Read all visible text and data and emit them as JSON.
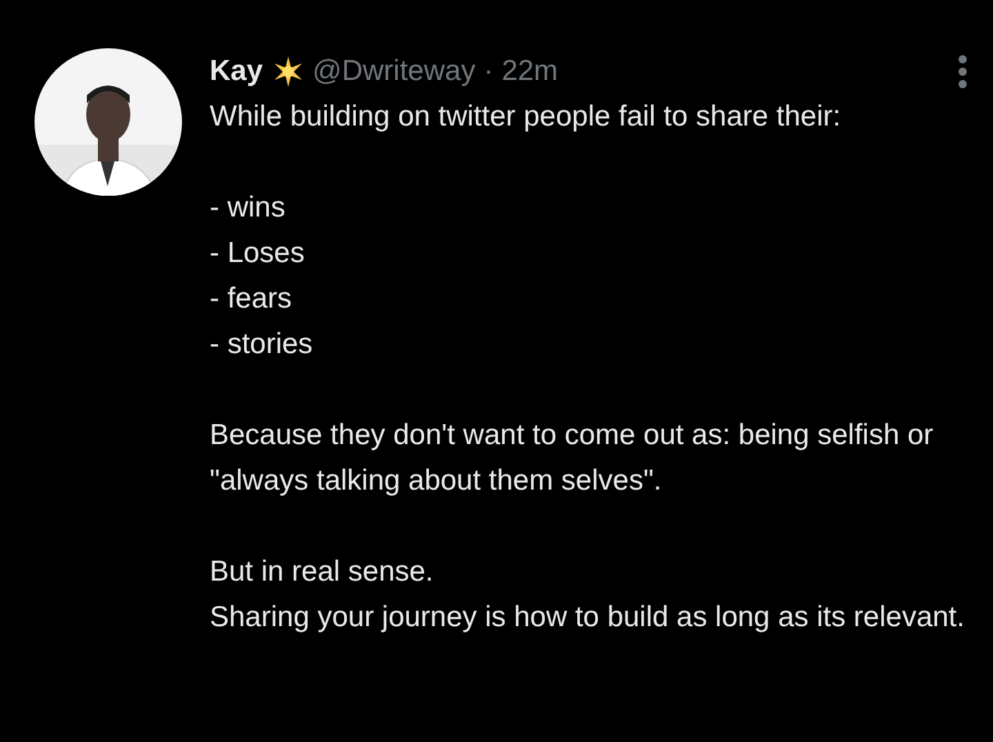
{
  "author": {
    "name": "Kay",
    "handle": "@Dwriteway",
    "separator": "·",
    "time": "22m"
  },
  "paragraphs": [
    {
      "lines": [
        "While building on twitter people fail to share their:"
      ]
    },
    {
      "lines": [
        "- wins",
        "- Loses",
        "- fears",
        "- stories"
      ]
    },
    {
      "lines": [
        "Because they don't want to come out as: being selfish or  \"always talking about them selves\"."
      ]
    },
    {
      "lines": [
        "But in real sense.",
        "Sharing your journey is how to build as long as its relevant."
      ]
    }
  ]
}
